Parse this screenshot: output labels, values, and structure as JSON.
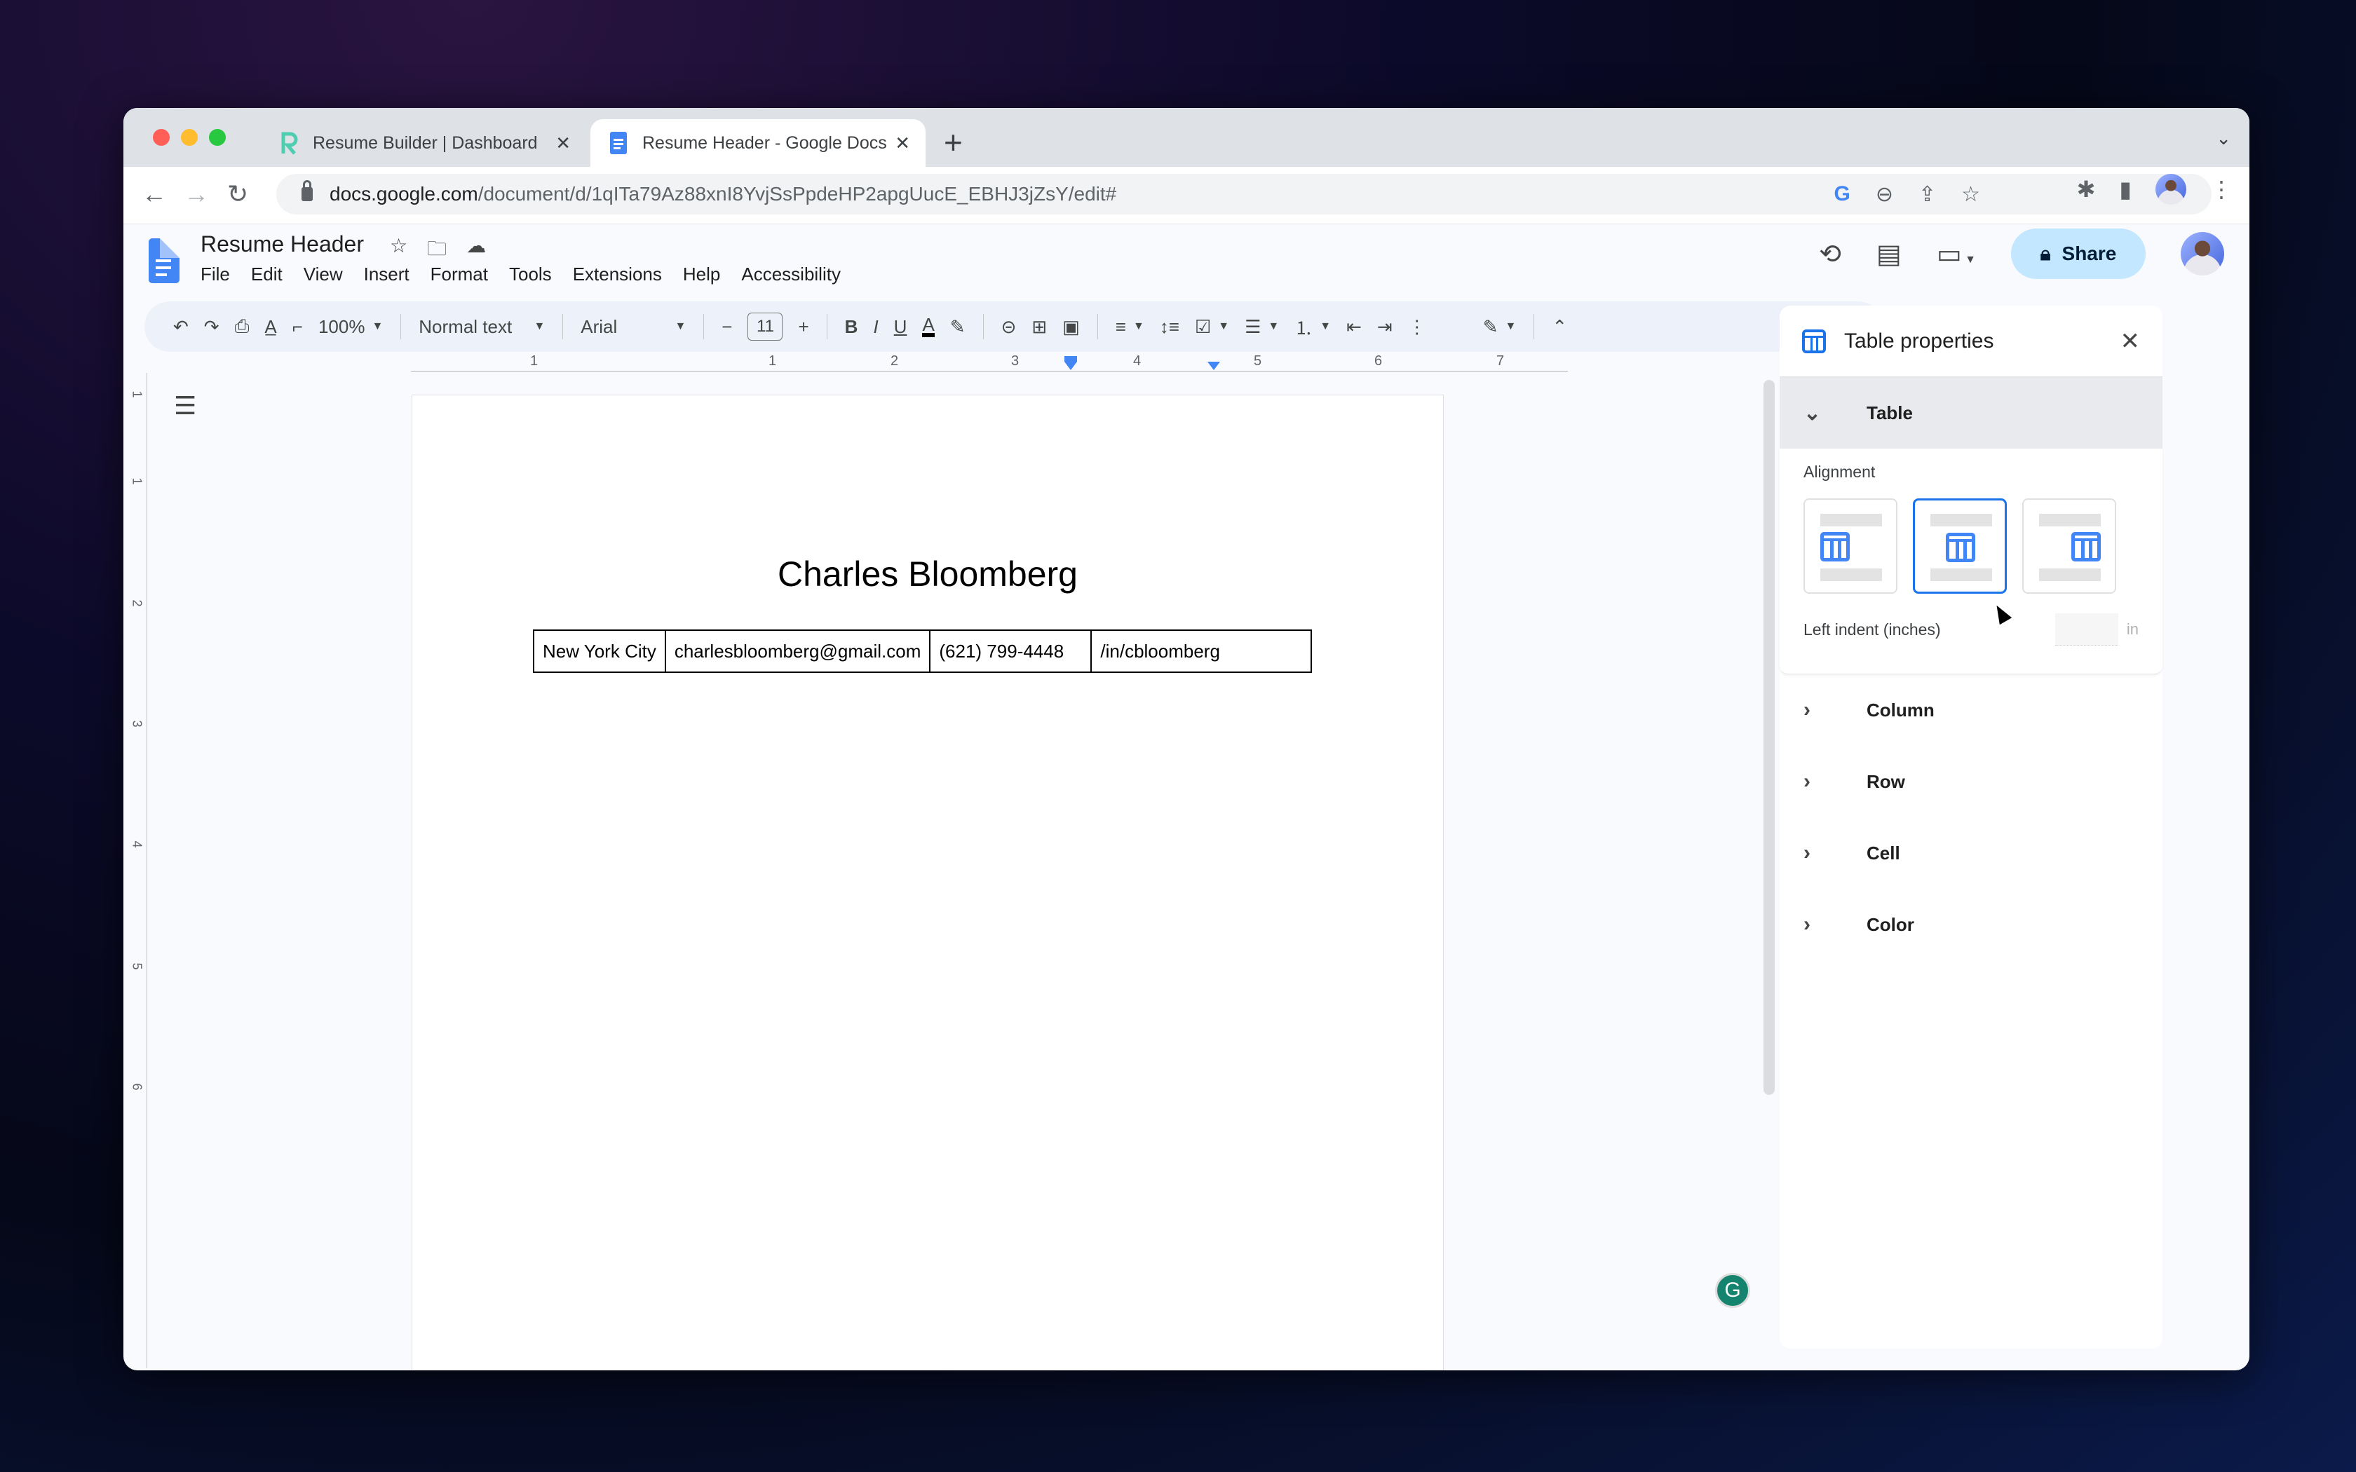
{
  "browser": {
    "tabs": [
      {
        "title": "Resume Builder | Dashboard",
        "icon": "resume-builder-icon",
        "active": false
      },
      {
        "title": "Resume Header - Google Docs",
        "icon": "google-docs-icon",
        "active": true
      }
    ],
    "new_tab": "+",
    "url_host": "docs.google.com",
    "url_path": "/document/d/1qITa79Az88xnI8YvjSsPpdeHP2apgUucE_EBHJ3jZsY/edit#"
  },
  "docs": {
    "title": "Resume Header",
    "menu": [
      "File",
      "Edit",
      "View",
      "Insert",
      "Format",
      "Tools",
      "Extensions",
      "Help",
      "Accessibility"
    ],
    "share_label": "Share",
    "toolbar": {
      "zoom": "100%",
      "style": "Normal text",
      "font": "Arial",
      "font_size": "11"
    },
    "ruler_h": [
      "1",
      "1",
      "2",
      "3",
      "4",
      "5",
      "6",
      "7"
    ],
    "ruler_v": [
      "1",
      "1",
      "2",
      "3",
      "4",
      "5",
      "6"
    ]
  },
  "document": {
    "name": "Charles Bloomberg",
    "table": [
      [
        "New York City",
        "charlesbloomberg@gmail.com",
        "(621) 799-4448",
        "/in/cbloomberg"
      ]
    ]
  },
  "panel": {
    "title": "Table properties",
    "sections": [
      {
        "label": "Table",
        "expanded": true
      },
      {
        "label": "Column",
        "expanded": false
      },
      {
        "label": "Row",
        "expanded": false
      },
      {
        "label": "Cell",
        "expanded": false
      },
      {
        "label": "Color",
        "expanded": false
      }
    ],
    "alignment_label": "Alignment",
    "alignment_options": [
      "left",
      "center",
      "right"
    ],
    "alignment_selected": "center",
    "left_indent_label": "Left indent (inches)",
    "left_indent_value": "",
    "left_indent_unit": "in"
  },
  "colors": {
    "accent": "#1a73e8",
    "share_bg": "#c2e7ff",
    "grammarly": "#15846f"
  }
}
